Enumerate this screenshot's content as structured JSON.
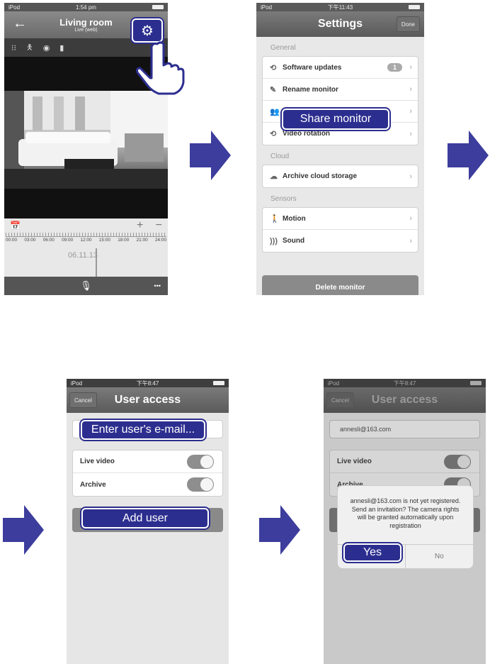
{
  "screen1": {
    "status": {
      "carrier": "iPod",
      "time": "1:54 pm"
    },
    "title": "Living room",
    "subtitle": "Live (web)",
    "timeline_ticks": [
      "00:00",
      "03:00",
      "06:00",
      "09:00",
      "12:00",
      "15:00",
      "18:00",
      "21:00",
      "24:00"
    ],
    "date": "06.11.13",
    "zoom_in": "+",
    "zoom_out": "−",
    "more": "•••"
  },
  "screen2": {
    "status": {
      "carrier": "iPod",
      "time": "下午11:43"
    },
    "title": "Settings",
    "done": "Done",
    "general_header": "General",
    "software_updates": "Software updates",
    "updates_badge": "1",
    "rename_monitor": "Rename monitor",
    "share_monitor": "Share monitor",
    "video_rotation": "Video rotation",
    "cloud_header": "Cloud",
    "archive_cloud_storage": "Archive cloud storage",
    "sensors_header": "Sensors",
    "motion": "Motion",
    "sound": "Sound",
    "delete_monitor": "Delete monitor"
  },
  "screen3": {
    "status": {
      "carrier": "iPod",
      "time": "下午8:47"
    },
    "cancel": "Cancel",
    "title": "User access",
    "email_placeholder": "Enter user's e-mail...",
    "live_video": "Live video",
    "archive": "Archive",
    "add_user": "Add user"
  },
  "screen4": {
    "status": {
      "carrier": "iPod",
      "time": "下午8:47"
    },
    "cancel": "Cancel",
    "title": "User access",
    "email_value": "annesli@163.com",
    "live_video": "Live video",
    "archive": "Archive",
    "dialog_message": "annesli@163.com is not yet registered. Send an invitation? The camera rights will be granted automatically upon registration",
    "yes": "Yes",
    "no": "No"
  },
  "colors": {
    "accent": "#2c2e8f",
    "arrow": "#3c3d9c"
  }
}
